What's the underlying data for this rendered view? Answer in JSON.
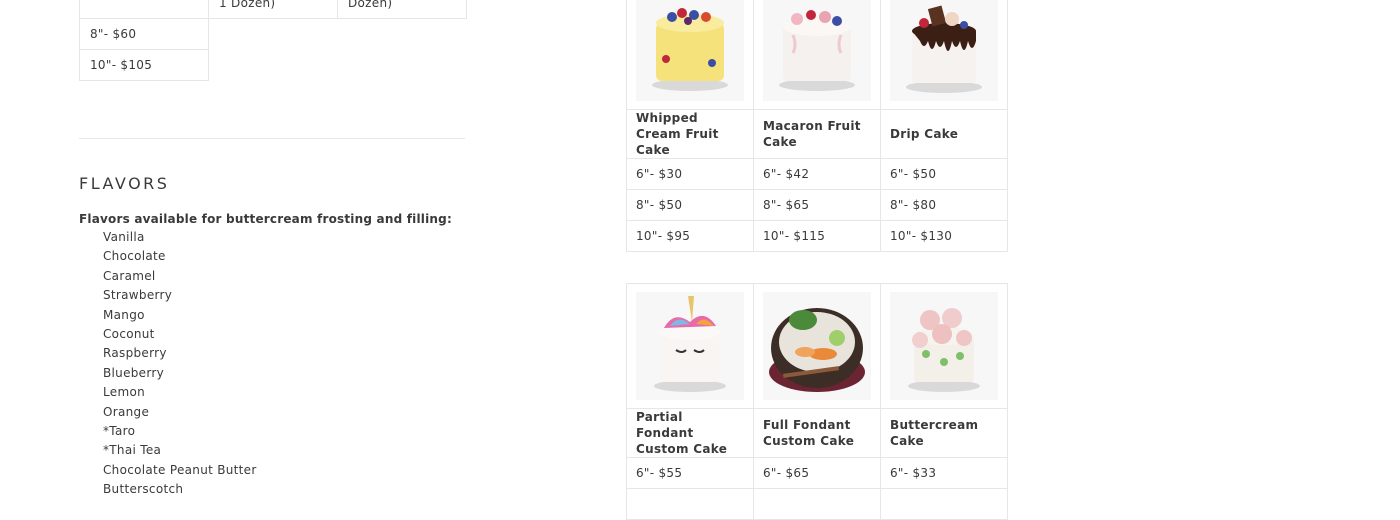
{
  "top_table": {
    "row0": [
      "",
      "1 Dozen)",
      "Dozen)"
    ],
    "rows": [
      "8\"- $60",
      "10\"- $105"
    ]
  },
  "flavors": {
    "title": "FLAVORS",
    "intro": "Flavors available for buttercream frosting and filling:",
    "items": [
      "Vanilla",
      "Chocolate",
      "Caramel",
      "Strawberry",
      "Mango",
      "Coconut",
      "Raspberry",
      "Blueberry",
      "Lemon",
      "Orange",
      "*Taro",
      "*Thai Tea",
      "Chocolate Peanut Butter",
      "Butterscotch"
    ]
  },
  "cakes_top": [
    {
      "name": "Whipped Cream Fruit Cake",
      "prices": [
        "6\"- $30",
        "8\"- $50",
        "10\"- $95"
      ]
    },
    {
      "name": "Macaron Fruit Cake",
      "prices": [
        "6\"- $42",
        "8\"- $65",
        "10\"- $115"
      ]
    },
    {
      "name": "Drip Cake",
      "prices": [
        "6\"- $50",
        "8\"- $80",
        "10\"- $130"
      ]
    }
  ],
  "cakes_bottom": [
    {
      "name": "Partial Fondant Custom Cake",
      "prices": [
        "6\"- $55"
      ]
    },
    {
      "name": "Full Fondant Custom Cake",
      "prices": [
        "6\"- $65"
      ]
    },
    {
      "name": "Buttercream Cake",
      "prices": [
        "6\"- $33"
      ]
    }
  ],
  "colors": {
    "text": "#3a3a3a",
    "border": "#e6e6e6"
  }
}
